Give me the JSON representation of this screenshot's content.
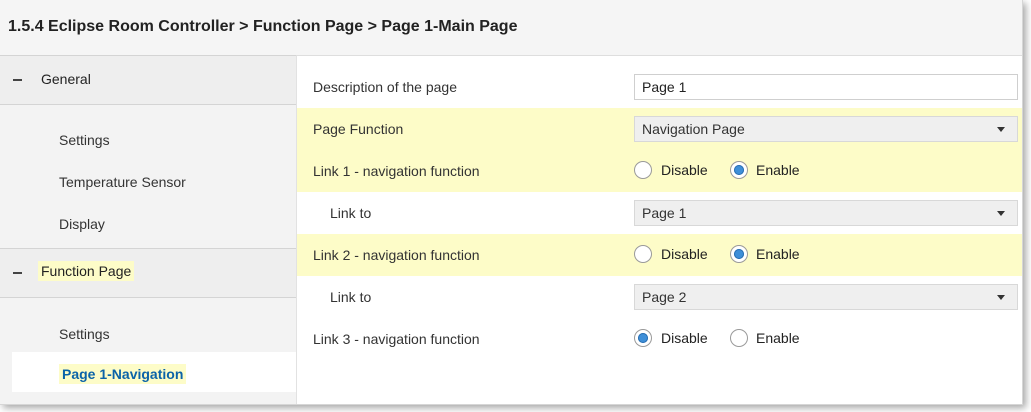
{
  "title": "1.5.4 Eclipse Room Controller > Function Page > Page 1-Main Page",
  "sidebar": {
    "groups": [
      {
        "label": "General",
        "items": [
          "Settings",
          "Temperature Sensor",
          "Display"
        ]
      },
      {
        "label": "Function Page",
        "items": [
          "Settings",
          "Page 1-Navigation"
        ]
      }
    ],
    "active_item": "Page 1-Navigation"
  },
  "form": {
    "description": {
      "label": "Description of the page",
      "value": "Page 1"
    },
    "page_function": {
      "label": "Page Function",
      "value": "Navigation Page"
    },
    "link1": {
      "label": "Link 1 - navigation function",
      "opt_disable": "Disable",
      "opt_enable": "Enable",
      "selected": "Enable"
    },
    "link1_to": {
      "label": "Link to",
      "value": "Page 1"
    },
    "link2": {
      "label": "Link 2 - navigation function",
      "opt_disable": "Disable",
      "opt_enable": "Enable",
      "selected": "Enable"
    },
    "link2_to": {
      "label": "Link to",
      "value": "Page 2"
    },
    "link3": {
      "label": "Link 3 - navigation function",
      "opt_disable": "Disable",
      "opt_enable": "Enable",
      "selected": "Disable"
    }
  },
  "colors": {
    "highlight": "#fdfcc8",
    "active_link": "#0b63a8",
    "radio_selected": "#3e8fd8"
  }
}
